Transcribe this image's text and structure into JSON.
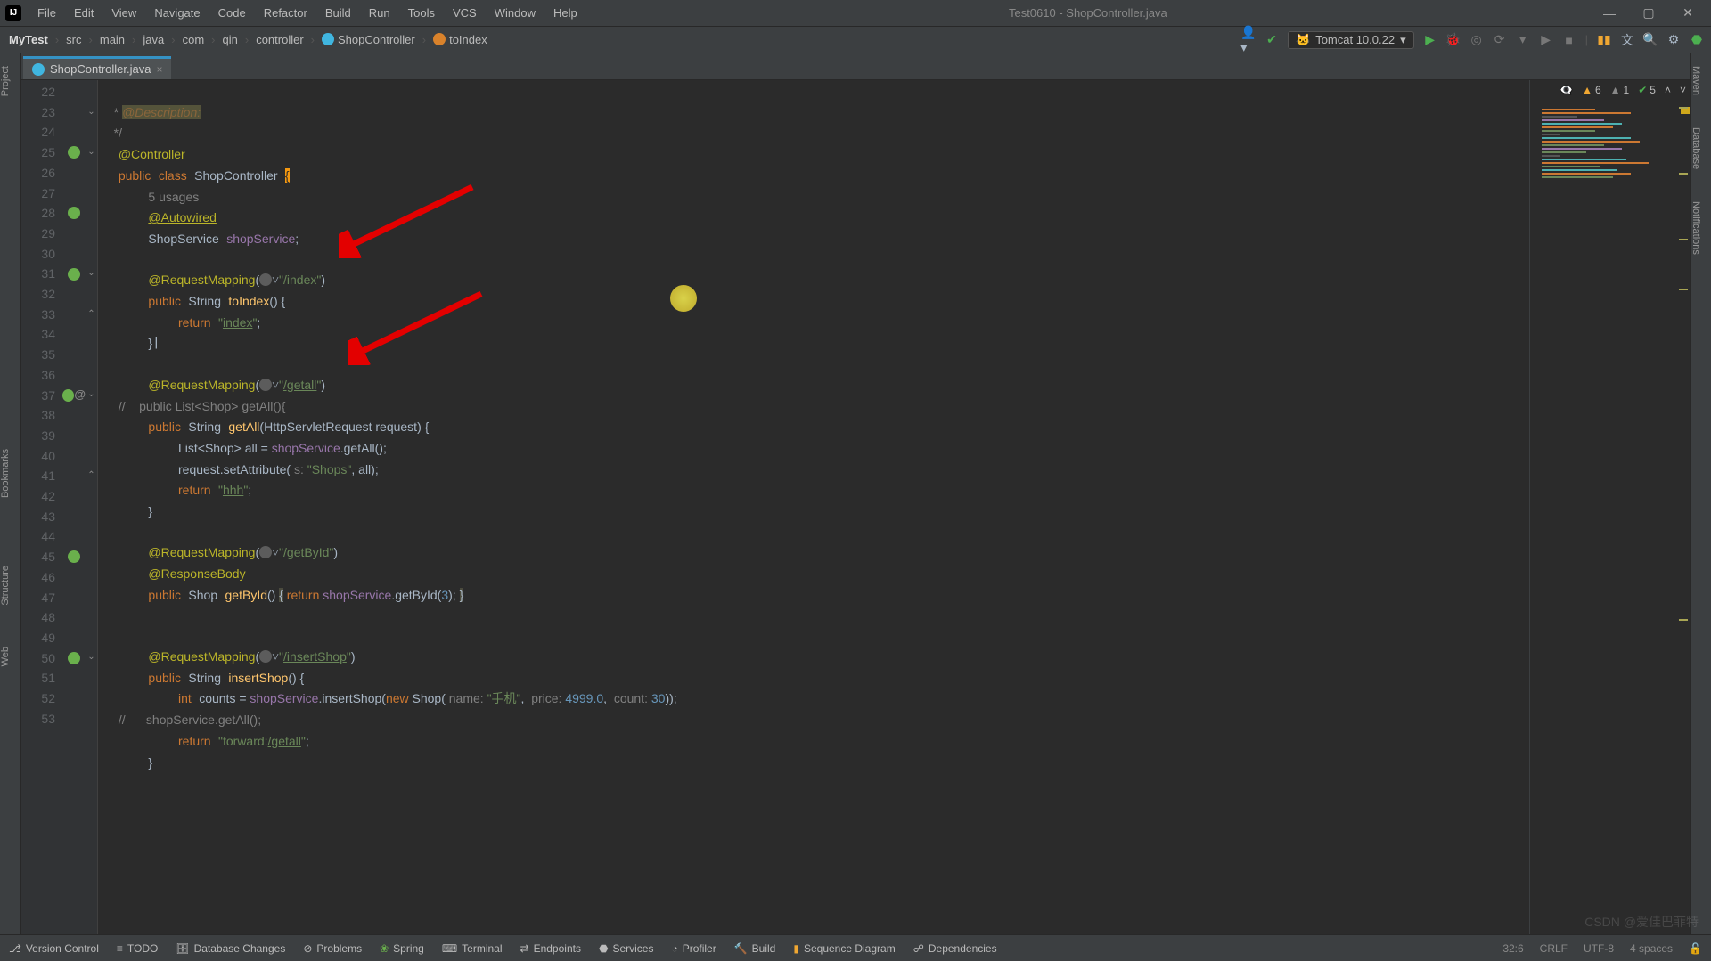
{
  "window": {
    "title": "Test0610 - ShopController.java"
  },
  "menu": [
    "File",
    "Edit",
    "View",
    "Navigate",
    "Code",
    "Refactor",
    "Build",
    "Run",
    "Tools",
    "VCS",
    "Window",
    "Help"
  ],
  "breadcrumbs": {
    "project": "MyTest",
    "parts": [
      "src",
      "main",
      "java",
      "com",
      "qin",
      "controller"
    ],
    "class": "ShopController",
    "method": "toIndex"
  },
  "run_config": {
    "icon": "tomcat",
    "label": "Tomcat 10.0.22"
  },
  "tab": {
    "name": "ShopController.java"
  },
  "side": {
    "left": [
      "Project",
      "Bookmarks",
      "Structure",
      "Web"
    ],
    "right": [
      "Maven",
      "Database",
      "Notifications"
    ]
  },
  "inspection": {
    "warnings_strong": "6",
    "warnings_weak": "1",
    "ok": "5"
  },
  "bottom_tools": [
    "Version Control",
    "TODO",
    "Database Changes",
    "Problems",
    "Spring",
    "Terminal",
    "Endpoints",
    "Services",
    "Profiler",
    "Build",
    "Sequence Diagram",
    "Dependencies"
  ],
  "status": {
    "cursor": "32:6",
    "eol": "CRLF",
    "enc": "UTF-8",
    "indent": "4 spaces"
  },
  "watermark": "CSDN @爱佳巴菲特",
  "line_numbers": [
    "22",
    "23",
    "24",
    "25",
    "",
    "26",
    "27",
    "28",
    "29",
    "30",
    "31",
    "32",
    "33",
    "34",
    "35",
    "36",
    "37",
    "38",
    "39",
    "40",
    "41",
    "42",
    "43",
    "44",
    "45",
    "46",
    "47",
    "48",
    "49",
    "50",
    "51",
    "52",
    "53"
  ],
  "code": {
    "l22_doc": "@Description:",
    "l23_doc": "*/",
    "l24_ann": "@Controller",
    "l25_kw1": "public",
    "l25_kw2": "class",
    "l25_name": "ShopController",
    "l25_brace": "{",
    "l25b_usages": "5 usages",
    "l26_ann": "@Autowired",
    "l27_type": "ShopService",
    "l27_field": "shopService",
    "l27_semi": ";",
    "l29_ann": "@RequestMapping",
    "l29_open": "(",
    "l29_str": "\"/index\"",
    "l29_close": ")",
    "l30_kw": "public",
    "l30_type": "String",
    "l30_name": "toIndex",
    "l30_rest": "() {",
    "l31_kw": "return",
    "l31_str": "\"",
    "l31_link": "index",
    "l31_strend": "\"",
    "l31_semi": ";",
    "l32": "}",
    "l34_ann": "@RequestMapping",
    "l34_open": "(",
    "l34_str1": "\"",
    "l34_link": "/getall",
    "l34_strend": "\"",
    "l34_close": ")",
    "l35_cmt": "//    public List<Shop> getAll(){",
    "l36_kw": "public",
    "l36_type": "String",
    "l36_name": "getAll",
    "l36_p1": "(HttpServletRequest ",
    "l36_pvar": "request",
    "l36_p2": ") {",
    "l37": "List<Shop> all = ",
    "l37_field": "shopService",
    "l37_call": ".getAll();",
    "l38": "request.setAttribute(",
    "l38_hint": " s: ",
    "l38_str": "\"Shops\"",
    "l38_rest": ", all);",
    "l39_kw": "return",
    "l39_str": "\"",
    "l39_link": "hhh",
    "l39_strend": "\"",
    "l39_semi": ";",
    "l40": "}",
    "l42_ann": "@RequestMapping",
    "l42_open": "(",
    "l42_str1": "\"",
    "l42_link": "/getById",
    "l42_strend": "\"",
    "l42_close": ")",
    "l43_ann": "@ResponseBody",
    "l44_kw": "public",
    "l44_type": "Shop",
    "l44_name": "getById",
    "l44_open": "() ",
    "l44_brace1": "{",
    "l44_ret": " return ",
    "l44_field": "shopService",
    "l44_call": ".getById(",
    "l44_num": "3",
    "l44_rest": "); ",
    "l44_brace2": "}",
    "l46_ann": "@RequestMapping",
    "l46_open": "(",
    "l46_str1": "\"",
    "l46_link": "/insertShop",
    "l46_strend": "\"",
    "l46_close": ")",
    "l47_kw": "public",
    "l47_type": "String",
    "l47_name": "insertShop",
    "l47_rest": "() {",
    "l48_kw": "int",
    "l48_var": "counts = ",
    "l48_field": "shopService",
    "l48_call": ".insertShop(",
    "l48_new": "new ",
    "l48_ctor": "Shop(",
    "l48_h1": " name: ",
    "l48_s1": "\"手机\"",
    "l48_c": ",  ",
    "l48_h2": "price: ",
    "l48_n1": "4999.0",
    "l48_c2": ",  ",
    "l48_h3": "count: ",
    "l48_n2": "30",
    "l48_end": "));",
    "l49_cmt": "//      shopService.getAll();",
    "l50_kw": "return",
    "l50_str": "\"forward:",
    "l50_link": "/getall",
    "l50_strend": "\"",
    "l50_semi": ";",
    "l51": "}"
  }
}
